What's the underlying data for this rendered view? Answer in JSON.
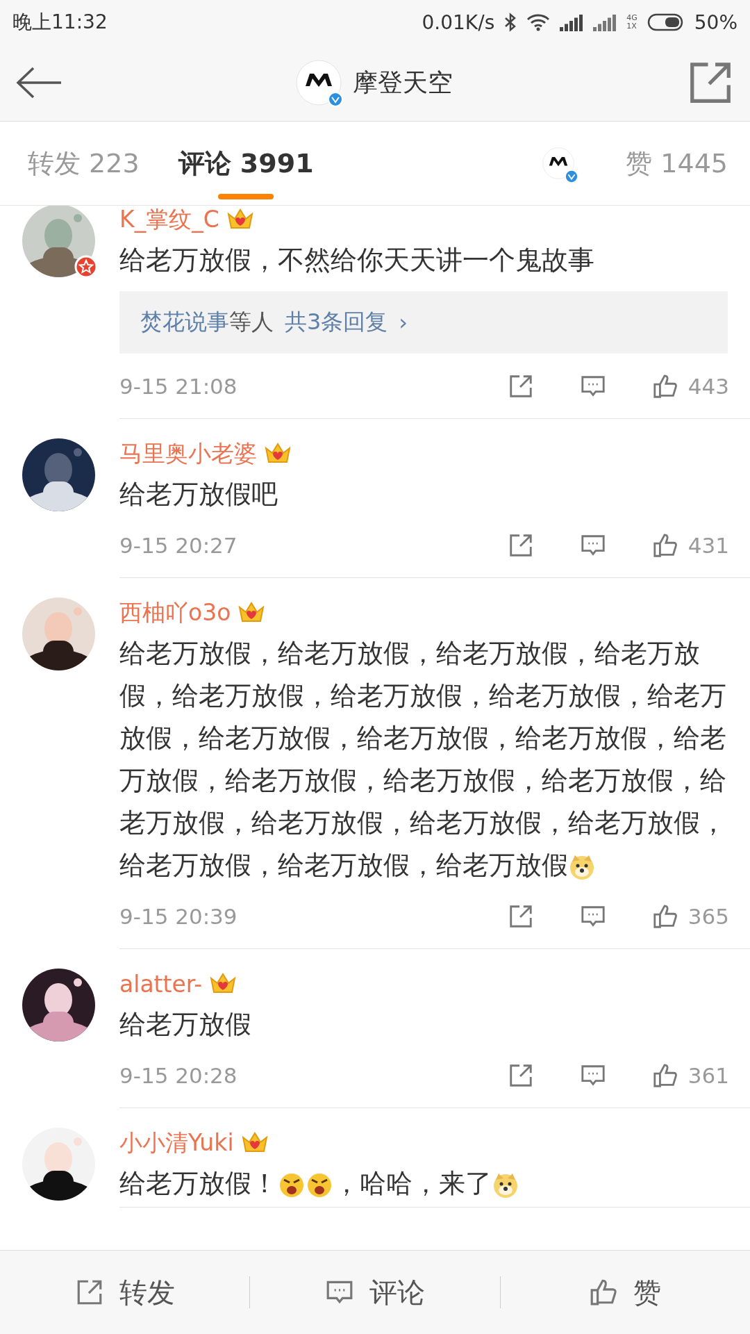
{
  "status_bar": {
    "time": "晚上11:32",
    "speed": "0.01K/s",
    "network_top": "4G",
    "network_bottom": "1X",
    "battery": "50%"
  },
  "header": {
    "title": "摩登天空"
  },
  "tabs": [
    {
      "label": "转发 223",
      "selected": false
    },
    {
      "label": "评论 3991",
      "selected": true
    }
  ],
  "likes_tab": {
    "label": "赞 1445"
  },
  "comments": [
    {
      "name": "K_掌纹_C",
      "badge": true,
      "parts": [
        {
          "kind": "text",
          "text": "给老万放假，不然给你天天讲一个鬼故事"
        }
      ],
      "replies": {
        "user": "焚花说事",
        "suffix": "等人",
        "link": "共3条回复",
        "arrow": "›"
      },
      "time": "9-15 21:08",
      "likes": "443"
    },
    {
      "name": "马里奥小老婆",
      "badge": false,
      "parts": [
        {
          "kind": "text",
          "text": "给老万放假吧"
        }
      ],
      "time": "9-15 20:27",
      "likes": "431"
    },
    {
      "name": "西柚吖o3o",
      "badge": false,
      "parts": [
        {
          "kind": "text",
          "text": "给老万放假，给老万放假，给老万放假，给老万放假，给老万放假，给老万放假，给老万放假，给老万放假，给老万放假，给老万放假，给老万放假，给老万放假，给老万放假，给老万放假，给老万放假，给老万放假，给老万放假，给老万放假，给老万放假，给老万放假，给老万放假，给老万放假"
        },
        {
          "kind": "dog"
        }
      ],
      "time": "9-15 20:39",
      "likes": "365"
    },
    {
      "name": "alatter-",
      "badge": false,
      "parts": [
        {
          "kind": "text",
          "text": "给老万放假"
        }
      ],
      "time": "9-15 20:28",
      "likes": "361"
    },
    {
      "name": "小小清Yuki",
      "badge": false,
      "parts": [
        {
          "kind": "text",
          "text": "给老万放假！"
        },
        {
          "kind": "angry"
        },
        {
          "kind": "angry"
        },
        {
          "kind": "text",
          "text": "，哈哈，来了"
        },
        {
          "kind": "dog"
        }
      ]
    }
  ],
  "bottom_bar": [
    {
      "kind": "share",
      "label": "转发"
    },
    {
      "kind": "comment",
      "label": "评论"
    },
    {
      "kind": "like",
      "label": "赞"
    }
  ]
}
